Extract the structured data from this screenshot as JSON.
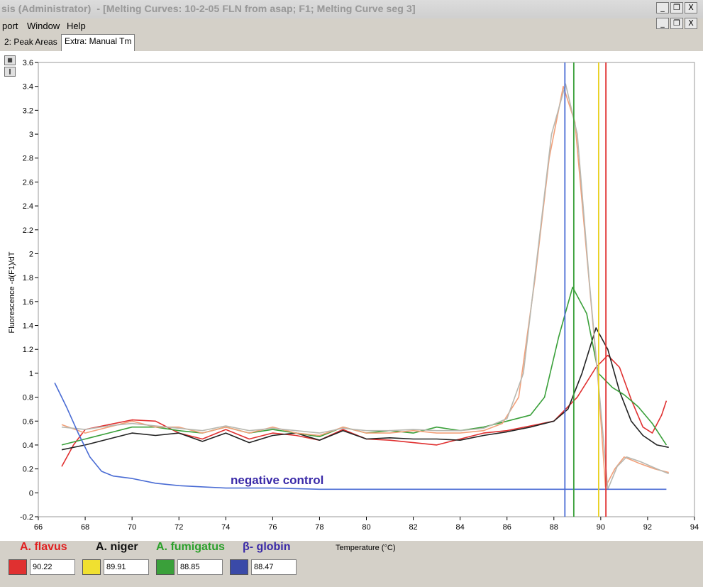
{
  "window": {
    "title_prefix": "sis (Administrator)",
    "title_doc": "- [Melting Curves: 10-2-05 FLN from asap; F1; Melting Curve seg 3]",
    "buttons": [
      "_",
      "❒",
      "X"
    ]
  },
  "menu": {
    "items": [
      "port",
      "Window",
      "Help"
    ]
  },
  "tabs": [
    {
      "label": "2: Peak Areas",
      "active": false
    },
    {
      "label": "Extra: Manual Tm",
      "active": true
    }
  ],
  "chart_data": {
    "type": "line",
    "ylabel": "Fluorescence -d(F1)/dT",
    "xlabel": "Temperature (°C)",
    "xlim": [
      66,
      94
    ],
    "ylim": [
      -0.2,
      3.6
    ],
    "x_ticks": [
      "66",
      "68",
      "70",
      "72",
      "74",
      "76",
      "78",
      "80",
      "82",
      "84",
      "86",
      "88",
      "90",
      "92",
      "94"
    ],
    "y_ticks": [
      "-0.2",
      "0",
      "0.2",
      "0.4",
      "0.6",
      "0.8",
      "1",
      "1.2",
      "1.4",
      "1.6",
      "1.8",
      "2",
      "2.2",
      "2.4",
      "2.6",
      "2.8",
      "3",
      "3.2",
      "3.4",
      "3.6"
    ],
    "annotation": "negative control",
    "series": [
      {
        "color": "#e03030",
        "points": [
          [
            67,
            0.22
          ],
          [
            67.5,
            0.4
          ],
          [
            68,
            0.53
          ],
          [
            69,
            0.57
          ],
          [
            70,
            0.61
          ],
          [
            71,
            0.6
          ],
          [
            72,
            0.5
          ],
          [
            73,
            0.45
          ],
          [
            74,
            0.53
          ],
          [
            75,
            0.45
          ],
          [
            76,
            0.5
          ],
          [
            77,
            0.48
          ],
          [
            78,
            0.44
          ],
          [
            79,
            0.53
          ],
          [
            80,
            0.45
          ],
          [
            81,
            0.44
          ],
          [
            82,
            0.42
          ],
          [
            83,
            0.4
          ],
          [
            84,
            0.45
          ],
          [
            85,
            0.5
          ],
          [
            86,
            0.52
          ],
          [
            87,
            0.56
          ],
          [
            88,
            0.6
          ],
          [
            89,
            0.8
          ],
          [
            89.8,
            1.05
          ],
          [
            90.3,
            1.15
          ],
          [
            90.8,
            1.05
          ],
          [
            91.3,
            0.78
          ],
          [
            91.8,
            0.55
          ],
          [
            92.2,
            0.5
          ],
          [
            92.6,
            0.65
          ],
          [
            92.8,
            0.77
          ]
        ]
      },
      {
        "color": "#222222",
        "points": [
          [
            67,
            0.36
          ],
          [
            68,
            0.4
          ],
          [
            69,
            0.45
          ],
          [
            70,
            0.5
          ],
          [
            71,
            0.48
          ],
          [
            72,
            0.5
          ],
          [
            73,
            0.43
          ],
          [
            74,
            0.5
          ],
          [
            75,
            0.42
          ],
          [
            76,
            0.48
          ],
          [
            77,
            0.5
          ],
          [
            78,
            0.44
          ],
          [
            79,
            0.52
          ],
          [
            80,
            0.45
          ],
          [
            81,
            0.46
          ],
          [
            82,
            0.45
          ],
          [
            83,
            0.45
          ],
          [
            84,
            0.44
          ],
          [
            85,
            0.48
          ],
          [
            86,
            0.51
          ],
          [
            87,
            0.55
          ],
          [
            88,
            0.6
          ],
          [
            88.6,
            0.7
          ],
          [
            89.2,
            1.0
          ],
          [
            89.8,
            1.38
          ],
          [
            90.3,
            1.2
          ],
          [
            90.8,
            0.85
          ],
          [
            91.3,
            0.6
          ],
          [
            91.8,
            0.48
          ],
          [
            92.4,
            0.4
          ],
          [
            92.9,
            0.38
          ]
        ]
      },
      {
        "color": "#3aa03a",
        "points": [
          [
            67,
            0.4
          ],
          [
            68,
            0.45
          ],
          [
            69,
            0.5
          ],
          [
            70,
            0.55
          ],
          [
            71,
            0.55
          ],
          [
            72,
            0.52
          ],
          [
            73,
            0.5
          ],
          [
            74,
            0.55
          ],
          [
            75,
            0.5
          ],
          [
            76,
            0.53
          ],
          [
            77,
            0.5
          ],
          [
            78,
            0.47
          ],
          [
            79,
            0.55
          ],
          [
            80,
            0.5
          ],
          [
            81,
            0.52
          ],
          [
            82,
            0.5
          ],
          [
            83,
            0.55
          ],
          [
            84,
            0.52
          ],
          [
            85,
            0.55
          ],
          [
            86,
            0.6
          ],
          [
            87,
            0.65
          ],
          [
            87.6,
            0.8
          ],
          [
            88.2,
            1.3
          ],
          [
            88.8,
            1.72
          ],
          [
            89.4,
            1.5
          ],
          [
            89.9,
            1.0
          ],
          [
            90.5,
            0.88
          ],
          [
            91,
            0.82
          ],
          [
            91.6,
            0.72
          ],
          [
            92.2,
            0.58
          ],
          [
            92.8,
            0.4
          ]
        ]
      },
      {
        "color": "#f2a07a",
        "points": [
          [
            67,
            0.57
          ],
          [
            68,
            0.5
          ],
          [
            69,
            0.55
          ],
          [
            70,
            0.6
          ],
          [
            71,
            0.55
          ],
          [
            72,
            0.55
          ],
          [
            73,
            0.5
          ],
          [
            74,
            0.55
          ],
          [
            75,
            0.5
          ],
          [
            76,
            0.55
          ],
          [
            77,
            0.5
          ],
          [
            78,
            0.48
          ],
          [
            79,
            0.55
          ],
          [
            80,
            0.5
          ],
          [
            81,
            0.5
          ],
          [
            82,
            0.52
          ],
          [
            83,
            0.5
          ],
          [
            84,
            0.5
          ],
          [
            85,
            0.52
          ],
          [
            85.8,
            0.58
          ],
          [
            86.5,
            0.8
          ],
          [
            87.2,
            1.8
          ],
          [
            87.8,
            2.8
          ],
          [
            88.4,
            3.4
          ],
          [
            88.9,
            3.1
          ],
          [
            89.4,
            2.0
          ],
          [
            89.9,
            0.9
          ],
          [
            90.2,
            0.05
          ],
          [
            90.6,
            0.2
          ],
          [
            91,
            0.3
          ],
          [
            91.6,
            0.25
          ],
          [
            92.3,
            0.2
          ],
          [
            92.9,
            0.17
          ]
        ]
      },
      {
        "color": "#b8b8b0",
        "points": [
          [
            67,
            0.55
          ],
          [
            68,
            0.53
          ],
          [
            69,
            0.56
          ],
          [
            70,
            0.58
          ],
          [
            71,
            0.56
          ],
          [
            72,
            0.54
          ],
          [
            73,
            0.52
          ],
          [
            74,
            0.56
          ],
          [
            75,
            0.52
          ],
          [
            76,
            0.54
          ],
          [
            77,
            0.52
          ],
          [
            78,
            0.5
          ],
          [
            79,
            0.54
          ],
          [
            80,
            0.52
          ],
          [
            81,
            0.52
          ],
          [
            82,
            0.53
          ],
          [
            83,
            0.52
          ],
          [
            84,
            0.52
          ],
          [
            85,
            0.54
          ],
          [
            86,
            0.62
          ],
          [
            86.7,
            1.0
          ],
          [
            87.3,
            2.0
          ],
          [
            87.9,
            3.0
          ],
          [
            88.5,
            3.42
          ],
          [
            89,
            3.0
          ],
          [
            89.5,
            1.8
          ],
          [
            90,
            0.7
          ],
          [
            90.3,
            0.03
          ],
          [
            90.7,
            0.22
          ],
          [
            91.1,
            0.3
          ],
          [
            91.7,
            0.26
          ],
          [
            92.4,
            0.2
          ],
          [
            92.9,
            0.16
          ]
        ]
      },
      {
        "color": "#4a6cd4",
        "points": [
          [
            66.7,
            0.92
          ],
          [
            67.2,
            0.72
          ],
          [
            67.7,
            0.5
          ],
          [
            68.2,
            0.3
          ],
          [
            68.7,
            0.18
          ],
          [
            69.2,
            0.14
          ],
          [
            70,
            0.12
          ],
          [
            71,
            0.08
          ],
          [
            72,
            0.06
          ],
          [
            73,
            0.05
          ],
          [
            74,
            0.04
          ],
          [
            76,
            0.04
          ],
          [
            78,
            0.03
          ],
          [
            80,
            0.03
          ],
          [
            82,
            0.03
          ],
          [
            84,
            0.03
          ],
          [
            86,
            0.03
          ],
          [
            88,
            0.03
          ],
          [
            90,
            0.03
          ],
          [
            92.8,
            0.03
          ]
        ]
      }
    ],
    "markers": [
      {
        "x": 88.47,
        "color": "#4a6cd4"
      },
      {
        "x": 88.85,
        "color": "#3aa03a"
      },
      {
        "x": 89.91,
        "color": "#e8d020"
      },
      {
        "x": 90.22,
        "color": "#e03030"
      }
    ]
  },
  "legend": {
    "flavus": {
      "label": "A. flavus",
      "color": "#e02020",
      "swatch": "#e03030",
      "tm": "90.22"
    },
    "niger": {
      "label": "A. niger",
      "color": "#111111",
      "swatch": "#f0e030",
      "tm": "89.91"
    },
    "fumigatus": {
      "label": "A. fumigatus",
      "color": "#2aa02a",
      "swatch": "#3aa03a",
      "tm": "88.85"
    },
    "globin": {
      "label": "β- globin",
      "color": "#3a2aa8",
      "swatch": "#3a4aa8",
      "tm": "88.47"
    }
  }
}
